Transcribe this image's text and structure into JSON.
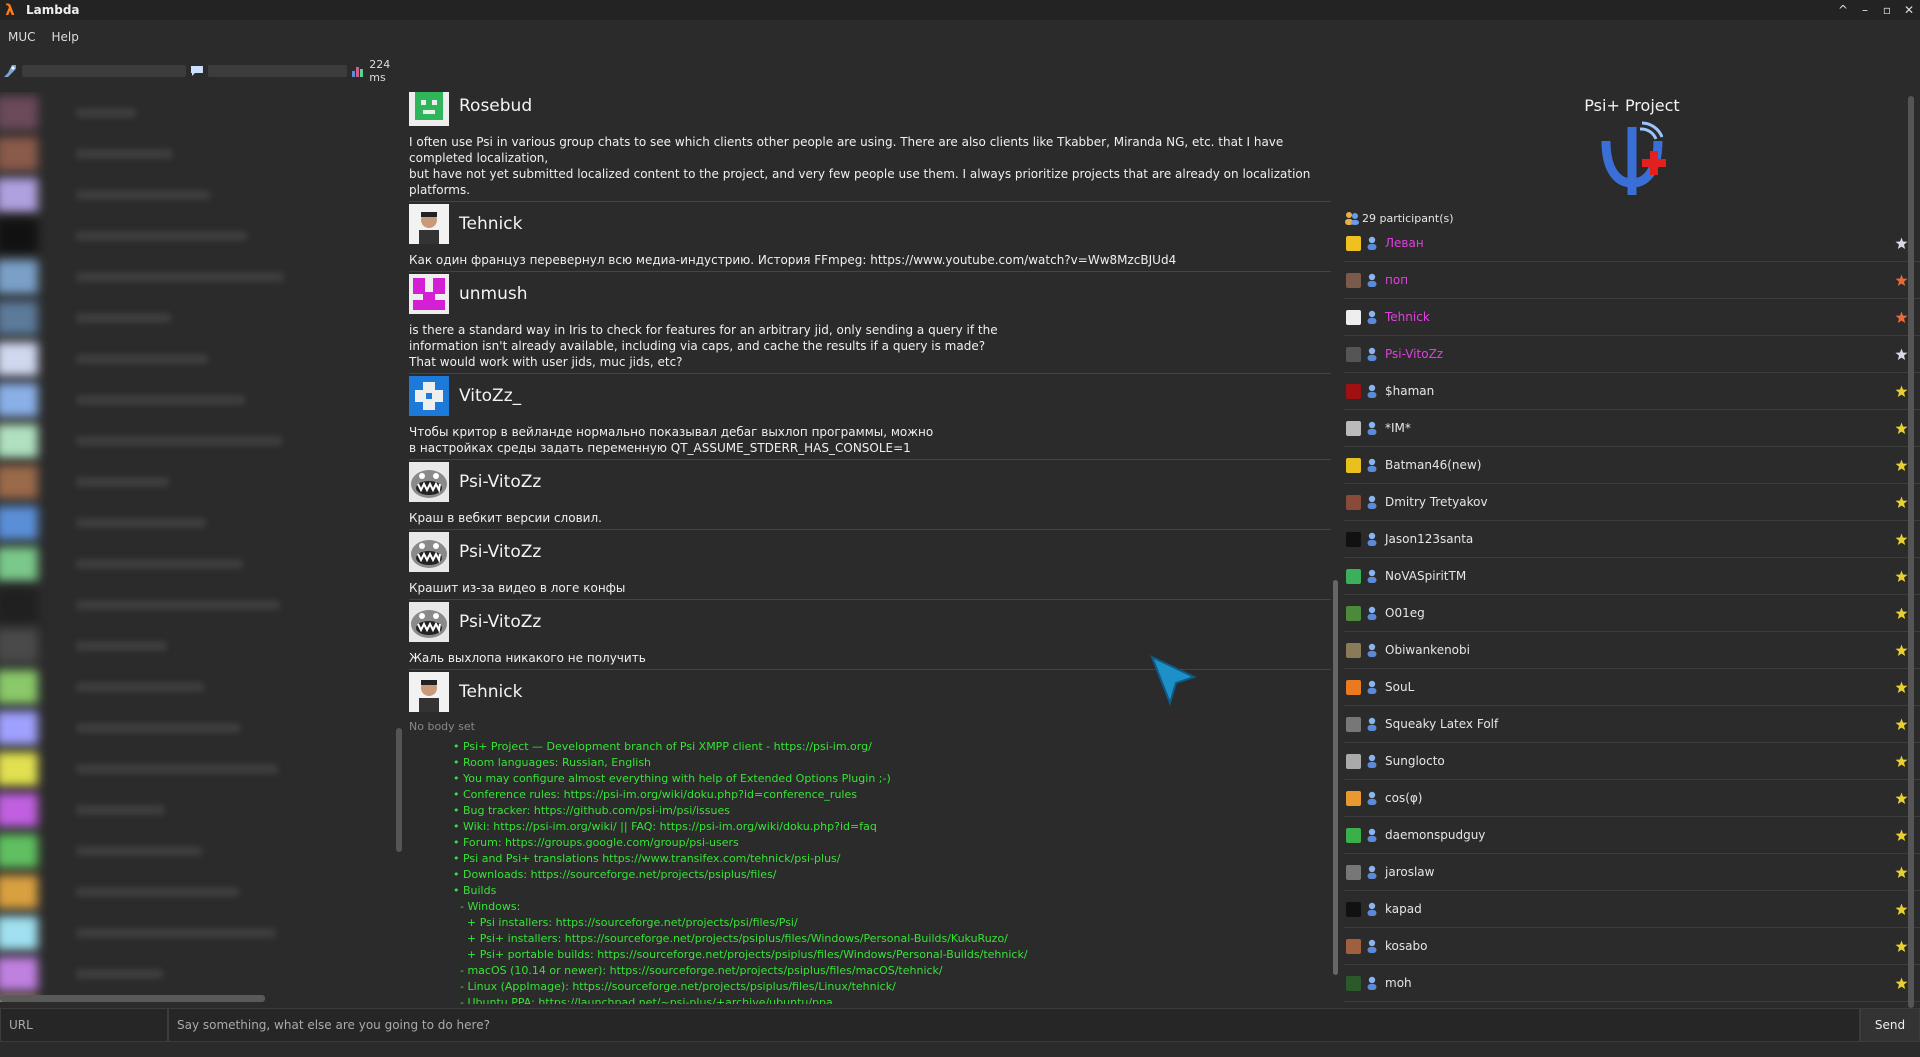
{
  "window": {
    "title": "Lambda",
    "controls": [
      "^",
      "–",
      "▫",
      "✕"
    ]
  },
  "menu": {
    "items": [
      "MUC",
      "Help"
    ]
  },
  "toolbar": {
    "ping": "224 ms"
  },
  "chat": {
    "messages": [
      {
        "nick": "Rosebud",
        "avatar": "green",
        "body": "I often use Psi in various group chats to see which clients other people are using. There are also clients like Tkabber, Miranda NG, etc. that I have completed localization,\nbut have not yet submitted localized content to the project, and very few people use them. I always prioritize projects that are already on localization platforms."
      },
      {
        "nick": "Tehnick",
        "avatar": "photo",
        "body": "Как один француз перевернул всю медиа-индустрию. История FFmpeg: https://www.youtube.com/watch?v=Ww8MzcBJUd4"
      },
      {
        "nick": "unmush",
        "avatar": "magenta",
        "body": "is there a standard way in Iris to check for features for an arbitrary jid, only sending a query if the\ninformation isn't already available, including via caps, and cache the results if a query is made?\nThat would work with user jids, muc jids, etc?"
      },
      {
        "nick": "VitoZz_",
        "avatar": "blue",
        "body": "Чтобы критор в вейланде нормально показывал дебаг выхлоп программы, можно\nв настройках среды задать переменную QT_ASSUME_STDERR_HAS_CONSOLE=1"
      },
      {
        "nick": "Psi-VitoZz",
        "avatar": "monster",
        "body": "Краш в вебкит версии словил."
      },
      {
        "nick": "Psi-VitoZz",
        "avatar": "monster",
        "body": "Крашит из-за видео в логе конфы"
      },
      {
        "nick": "Psi-VitoZz",
        "avatar": "monster",
        "body": "Жаль выхлопа никакого не получить"
      }
    ],
    "last_nick": "Tehnick",
    "no_body": "No body set",
    "topic": "• Psi+ Project — Development branch of Psi XMPP client - https://psi-im.org/\n• Room languages: Russian, English\n• You may configure almost everything with help of Extended Options Plugin ;-)\n• Conference rules: https://psi-im.org/wiki/doku.php?id=conference_rules\n• Bug tracker: https://github.com/psi-im/psi/issues\n• Wiki: https://psi-im.org/wiki/ || FAQ: https://psi-im.org/wiki/doku.php?id=faq\n• Forum: https://groups.google.com/group/psi-users\n• Psi and Psi+ translations https://www.transifex.com/tehnick/psi-plus/\n• Downloads: https://sourceforge.net/projects/psiplus/files/\n• Builds\n  - Windows:\n    + Psi installers: https://sourceforge.net/projects/psi/files/Psi/\n    + Psi+ installers: https://sourceforge.net/projects/psiplus/files/Windows/Personal-Builds/KukuRuzo/\n    + Psi+ portable builds: https://sourceforge.net/projects/psiplus/files/Windows/Personal-Builds/tehnick/\n  - macOS (10.14 or newer): https://sourceforge.net/projects/psiplus/files/macOS/tehnick/\n  - Linux (AppImage): https://sourceforge.net/projects/psiplus/files/Linux/tehnick/\n  - Ubuntu PPA: https://launchpad.net/~psi-plus/+archive/ubuntu/ppa\n  - Debian PPA: https://psi-im.org/wiki/doku.php?id=en:debian#nightly_builds"
  },
  "room": {
    "title": "Psi+ Project",
    "participant_count": "29 participant(s)",
    "participants": [
      {
        "name": "Леван",
        "color": "#e040e0",
        "role": "moderator"
      },
      {
        "name": "поп",
        "color": "#e040e0",
        "role": "owner"
      },
      {
        "name": "Tehnick",
        "color": "#e040e0",
        "role": "owner"
      },
      {
        "name": "Psi-VitoZz",
        "color": "#e040e0",
        "role": "moderator"
      },
      {
        "name": "$haman",
        "color": "#e6e6e6",
        "role": "member"
      },
      {
        "name": "*IM*",
        "color": "#e6e6e6",
        "role": "member"
      },
      {
        "name": "Batman46(new)",
        "color": "#e6e6e6",
        "role": "member"
      },
      {
        "name": "Dmitry Tretyakov",
        "color": "#e6e6e6",
        "role": "member"
      },
      {
        "name": "Jason123santa",
        "color": "#e6e6e6",
        "role": "member"
      },
      {
        "name": "NoVASpiritTM",
        "color": "#e6e6e6",
        "role": "member"
      },
      {
        "name": "O01eg",
        "color": "#e6e6e6",
        "role": "member"
      },
      {
        "name": "Obiwankenobi",
        "color": "#e6e6e6",
        "role": "member"
      },
      {
        "name": "SouL",
        "color": "#e6e6e6",
        "role": "member"
      },
      {
        "name": "Squeaky Latex Folf",
        "color": "#e6e6e6",
        "role": "member"
      },
      {
        "name": "Sunglocto",
        "color": "#e6e6e6",
        "role": "member"
      },
      {
        "name": "cos(φ)",
        "color": "#e6e6e6",
        "role": "member"
      },
      {
        "name": "daemonspudguy",
        "color": "#e6e6e6",
        "role": "member"
      },
      {
        "name": "jaroslaw",
        "color": "#e6e6e6",
        "role": "member"
      },
      {
        "name": "kapad",
        "color": "#e6e6e6",
        "role": "member"
      },
      {
        "name": "kosabo",
        "color": "#e6e6e6",
        "role": "member"
      },
      {
        "name": "moh",
        "color": "#e6e6e6",
        "role": "member"
      }
    ]
  },
  "input": {
    "url_placeholder": "URL",
    "message_placeholder": "Say something, what else are you going to do here?",
    "send_label": "Send"
  },
  "colors": {
    "topic": "#36e336",
    "background": "#2b2b2b",
    "highlight": "#e040e0"
  }
}
